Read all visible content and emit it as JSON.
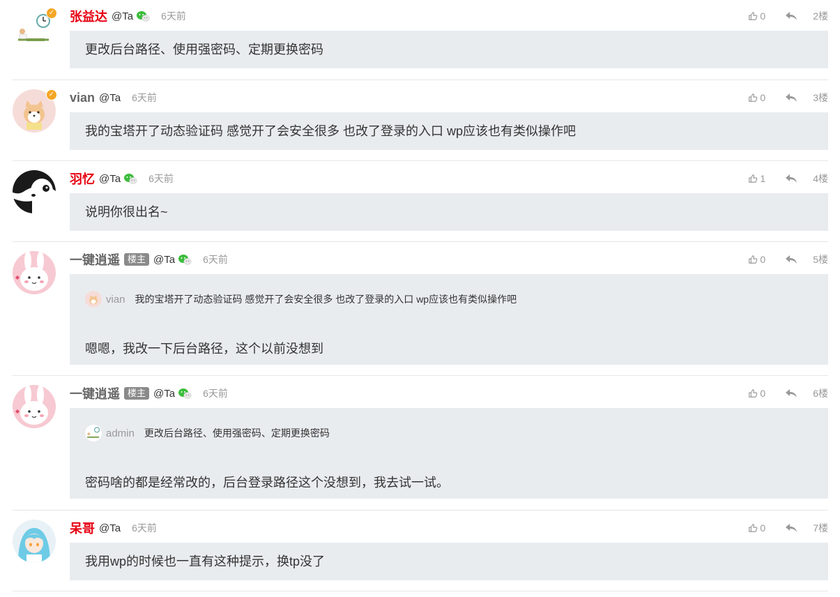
{
  "comments": [
    {
      "name": "张益达",
      "name_color": "#e60012",
      "at": "@Ta",
      "time": "6天前",
      "likes": "0",
      "floor": "2楼",
      "content": "更改后台路径、使用强密码、定期更换密码",
      "wechat": true,
      "verified": true,
      "avatar_icon": "person-clock-avatar"
    },
    {
      "name": "vian",
      "name_color": "#666666",
      "at": "@Ta",
      "time": "6天前",
      "likes": "0",
      "floor": "3楼",
      "content": "我的宝塔开了动态验证码 感觉开了会安全很多 也改了登录的入口 wp应该也有类似操作吧",
      "wechat": false,
      "verified": true,
      "avatar_icon": "shiba-dog-avatar"
    },
    {
      "name": "羽忆",
      "name_color": "#e60012",
      "at": "@Ta",
      "time": "6天前",
      "likes": "1",
      "floor": "4楼",
      "content": "说明你很出名~",
      "wechat": true,
      "verified": false,
      "avatar_icon": "panda-avatar"
    },
    {
      "name": "一键逍遥",
      "tag": "楼主",
      "name_color": "#666666",
      "at": "@Ta",
      "time": "6天前",
      "likes": "0",
      "floor": "5楼",
      "quote_name": "vian",
      "quote_text": "我的宝塔开了动态验证码 感觉开了会安全很多 也改了登录的入口 wp应该也有类似操作吧",
      "content": "嗯嗯，我改一下后台路径，这个以前没想到",
      "wechat": true,
      "verified": false,
      "avatar_icon": "bunny-avatar"
    },
    {
      "name": "一键逍遥",
      "tag": "楼主",
      "name_color": "#666666",
      "at": "@Ta",
      "time": "6天前",
      "likes": "0",
      "floor": "6楼",
      "quote_name": "admin",
      "quote_text": "更改后台路径、使用强密码、定期更换密码",
      "content": "密码啥的都是经常改的，后台登录路径这个没想到，我去试一试。",
      "wechat": true,
      "verified": false,
      "avatar_icon": "bunny-avatar"
    },
    {
      "name": "呆哥",
      "name_color": "#e60012",
      "at": "@Ta",
      "time": "6天前",
      "likes": "0",
      "floor": "7楼",
      "content": "我用wp的时候也一直有这种提示，换tp没了",
      "wechat": false,
      "verified": false,
      "avatar_icon": "anime-girl-avatar"
    }
  ]
}
